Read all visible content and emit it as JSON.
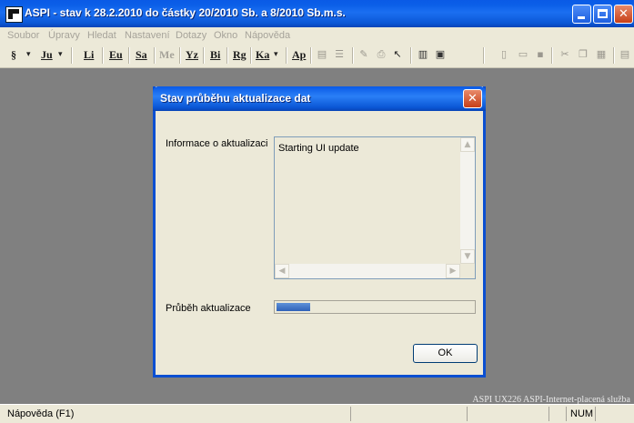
{
  "window": {
    "title": "ASPI  - stav k 28.2.2010 do částky 20/2010 Sb. a 8/2010 Sb.m.s.",
    "minimize_icon": "minimize-icon",
    "maximize_icon": "maximize-icon",
    "close_glyph": "✕"
  },
  "menu": {
    "items": [
      "Soubor",
      "Úpravy",
      "Hledat",
      "Nastavení",
      "Dotazy",
      "Okno",
      "Nápověda"
    ]
  },
  "toolbar": {
    "buttons": [
      "§",
      "Ju",
      "Li",
      "Eu",
      "Sa",
      "Me",
      "Yz",
      "Bi",
      "Rg",
      "Ka",
      "Ap"
    ],
    "dropdown_glyph": "▾"
  },
  "workspace": {
    "footer_info": "ASPI UX226 ASPI-Internet-placená služba"
  },
  "statusbar": {
    "help": "Nápověda (F1)",
    "num": "NUM"
  },
  "dialog": {
    "title": "Stav průběhu aktualizace dat",
    "close_glyph": "✕",
    "info_label": "Informace o aktualizaci",
    "info_text": "Starting UI update",
    "progress_label": "Průběh aktualizace",
    "progress_fraction": 0.17,
    "ok_label": "OK"
  },
  "colors": {
    "titlebar_blue": "#0b57d6",
    "progress_blue": "#2f62b8",
    "workspace_gray": "#808080",
    "dialog_face": "#ece9d8"
  }
}
